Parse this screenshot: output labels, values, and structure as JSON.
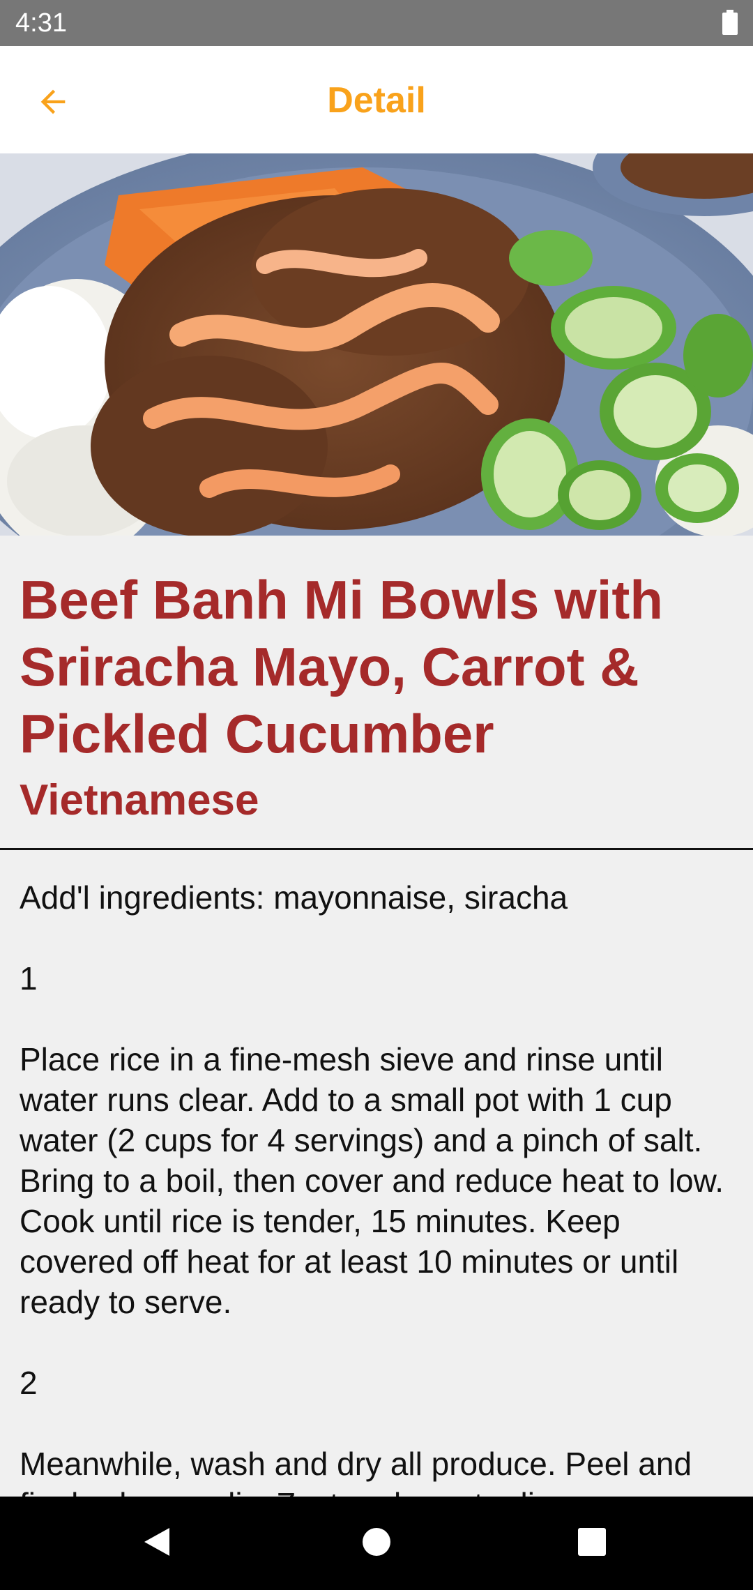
{
  "status_bar": {
    "time": "4:31",
    "battery_icon": "battery-full-icon"
  },
  "app_bar": {
    "back_icon": "arrow-left-icon",
    "title": "Detail",
    "accent_color": "#f9a21b"
  },
  "hero_image": {
    "description_icon": "beef-banh-mi-bowl-photo"
  },
  "recipe": {
    "title": "Beef Banh Mi Bowls with Sriracha Mayo, Carrot & Pickled Cucumber",
    "cuisine": "Vietnamese",
    "title_color": "#a52a2a",
    "instructions": "Add'l ingredients: mayonnaise, siracha\n\n1\n\nPlace rice in a fine-mesh sieve and rinse until water runs clear. Add to a small pot with 1 cup water (2 cups for 4 servings) and a pinch of salt. Bring to a boil, then cover and reduce heat to low. Cook until rice is tender, 15 minutes. Keep covered off heat for at least 10 minutes or until ready to serve.\n\n2\n\nMeanwhile, wash and dry all produce. Peel and finely chop garlic. Zest and quarter lime."
  },
  "nav_bar": {
    "back_icon": "triangle-back-icon",
    "home_icon": "circle-home-icon",
    "recents_icon": "square-recents-icon"
  }
}
